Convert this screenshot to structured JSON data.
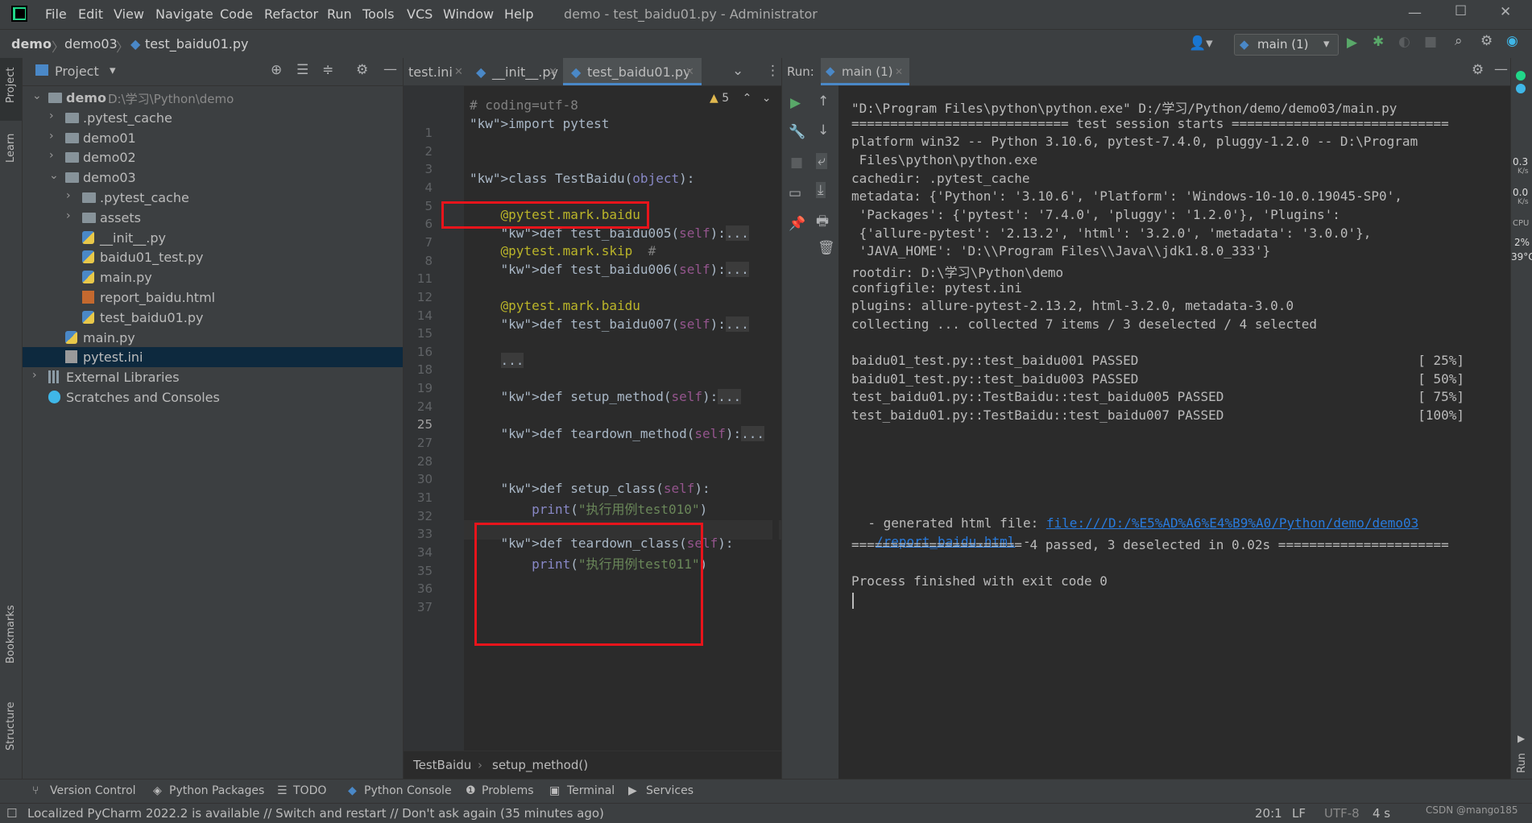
{
  "menu": [
    "File",
    "Edit",
    "View",
    "Navigate",
    "Code",
    "Refactor",
    "Run",
    "Tools",
    "VCS",
    "Window",
    "Help"
  ],
  "window_title": "demo - test_baidu01.py - Administrator",
  "nav": {
    "crumbs": [
      "demo",
      "demo03",
      "test_baidu01.py"
    ],
    "run_config": "main (1)"
  },
  "left_stripe": {
    "project": "Project",
    "learn": "Learn",
    "bookmarks": "Bookmarks",
    "structure": "Structure"
  },
  "project_panel": {
    "title": "Project",
    "tree": [
      {
        "label": "demo",
        "extra": "D:\\学习\\Python\\demo",
        "type": "folder",
        "expanded": true
      },
      {
        "label": ".pytest_cache",
        "type": "folder"
      },
      {
        "label": "demo01",
        "type": "folder"
      },
      {
        "label": "demo02",
        "type": "folder"
      },
      {
        "label": "demo03",
        "type": "folder",
        "expanded": true
      },
      {
        "label": ".pytest_cache",
        "type": "folder"
      },
      {
        "label": "assets",
        "type": "folder"
      },
      {
        "label": "__init__.py",
        "type": "py"
      },
      {
        "label": "baidu01_test.py",
        "type": "py"
      },
      {
        "label": "main.py",
        "type": "py"
      },
      {
        "label": "report_baidu.html",
        "type": "html"
      },
      {
        "label": "test_baidu01.py",
        "type": "py"
      },
      {
        "label": "main.py",
        "type": "py"
      },
      {
        "label": "pytest.ini",
        "type": "ini",
        "selected": true
      },
      {
        "label": "External Libraries",
        "type": "lib"
      },
      {
        "label": "Scratches and Consoles",
        "type": "scratch"
      }
    ]
  },
  "editor": {
    "tabs": [
      "test.ini",
      "__init__.py",
      "test_baidu01.py"
    ],
    "warning_count": "5",
    "lines": [
      {
        "n": "1",
        "text": "# coding=utf-8"
      },
      {
        "n": "2",
        "text": "import pytest"
      },
      {
        "n": "3",
        "text": ""
      },
      {
        "n": "4",
        "text": ""
      },
      {
        "n": "5",
        "text": "class TestBaidu(object):"
      },
      {
        "n": "6",
        "text": ""
      },
      {
        "n": "7",
        "text": "    @pytest.mark.baidu"
      },
      {
        "n": "8",
        "text": "    def test_baidu005(self):..."
      },
      {
        "n": "11",
        "text": "    @pytest.mark.skip  #"
      },
      {
        "n": "12",
        "text": "    def test_baidu006(self):..."
      },
      {
        "n": "14",
        "text": ""
      },
      {
        "n": "15",
        "text": "    @pytest.mark.baidu"
      },
      {
        "n": "16",
        "text": "    def test_baidu007(self):..."
      },
      {
        "n": "18",
        "text": ""
      },
      {
        "n": "19",
        "text": "    ..."
      },
      {
        "n": "24",
        "text": ""
      },
      {
        "n": "25",
        "text": "    def setup_method(self):..."
      },
      {
        "n": "27",
        "text": ""
      },
      {
        "n": "28",
        "text": "    def teardown_method(self):..."
      },
      {
        "n": "30",
        "text": ""
      },
      {
        "n": "31",
        "text": ""
      },
      {
        "n": "32",
        "text": "    def setup_class(self):"
      },
      {
        "n": "33",
        "text": "        print(\"执行用例test010\")"
      },
      {
        "n": "34",
        "text": ""
      },
      {
        "n": "35",
        "text": "    def teardown_class(self):"
      },
      {
        "n": "36",
        "text": "        print(\"执行用例test011\")"
      },
      {
        "n": "37",
        "text": ""
      }
    ],
    "breadcrumb": [
      "TestBaidu",
      "setup_method()"
    ]
  },
  "run_panel": {
    "label": "Run:",
    "tab": "main (1)",
    "output": [
      "\"D:\\Program Files\\python\\python.exe\" D:/学习/Python/demo/demo03/main.py",
      "============================ test session starts ============================",
      "platform win32 -- Python 3.10.6, pytest-7.4.0, pluggy-1.2.0 -- D:\\Program",
      " Files\\python\\python.exe",
      "cachedir: .pytest_cache",
      "metadata: {'Python': '3.10.6', 'Platform': 'Windows-10-10.0.19045-SP0',",
      " 'Packages': {'pytest': '7.4.0', 'pluggy': '1.2.0'}, 'Plugins':",
      " {'allure-pytest': '2.13.2', 'html': '3.2.0', 'metadata': '3.0.0'},",
      " 'JAVA_HOME': 'D:\\\\Program Files\\\\Java\\\\jdk1.8.0_333'}",
      "rootdir: D:\\学习\\Python\\demo",
      "configfile: pytest.ini",
      "plugins: allure-pytest-2.13.2, html-3.2.0, metadata-3.0.0",
      "collecting ... collected 7 items / 3 deselected / 4 selected",
      "",
      "baidu01_test.py::test_baidu001 PASSED                                    [ 25%]",
      "baidu01_test.py::test_baidu003 PASSED                                    [ 50%]",
      "test_baidu01.py::TestBaidu::test_baidu005 PASSED                         [ 75%]",
      "test_baidu01.py::TestBaidu::test_baidu007 PASSED                         [100%]",
      ""
    ],
    "html_prefix": "- generated html file: ",
    "html_link_1": "file:///D:/%E5%AD%A6%E4%B9%A0/Python/demo/demo03",
    "html_link_2": "/report_baidu.html",
    "html_suffix": " -",
    "summary": "====================== 4 passed, 3 deselected in 0.02s ======================",
    "exit": "Process finished with exit code 0"
  },
  "right_stripe": {
    "v1": "0.3",
    "u1": "K/s",
    "v2": "0.0",
    "u2": "K/s",
    "cpu": "CPU",
    "cpu_v": "2%",
    "temp": "39°C",
    "run": "Run"
  },
  "tool_windows": [
    "Version Control",
    "Python Packages",
    "TODO",
    "Python Console",
    "Problems",
    "Terminal",
    "Services"
  ],
  "status": {
    "message": "Localized PyCharm 2022.2 is available // Switch and restart // Don't ask again (35 minutes ago)",
    "position": "20:1",
    "line_sep": "LF",
    "encoding": "UTF-8",
    "indent": "4 s",
    "watermark": "CSDN @mango185"
  }
}
